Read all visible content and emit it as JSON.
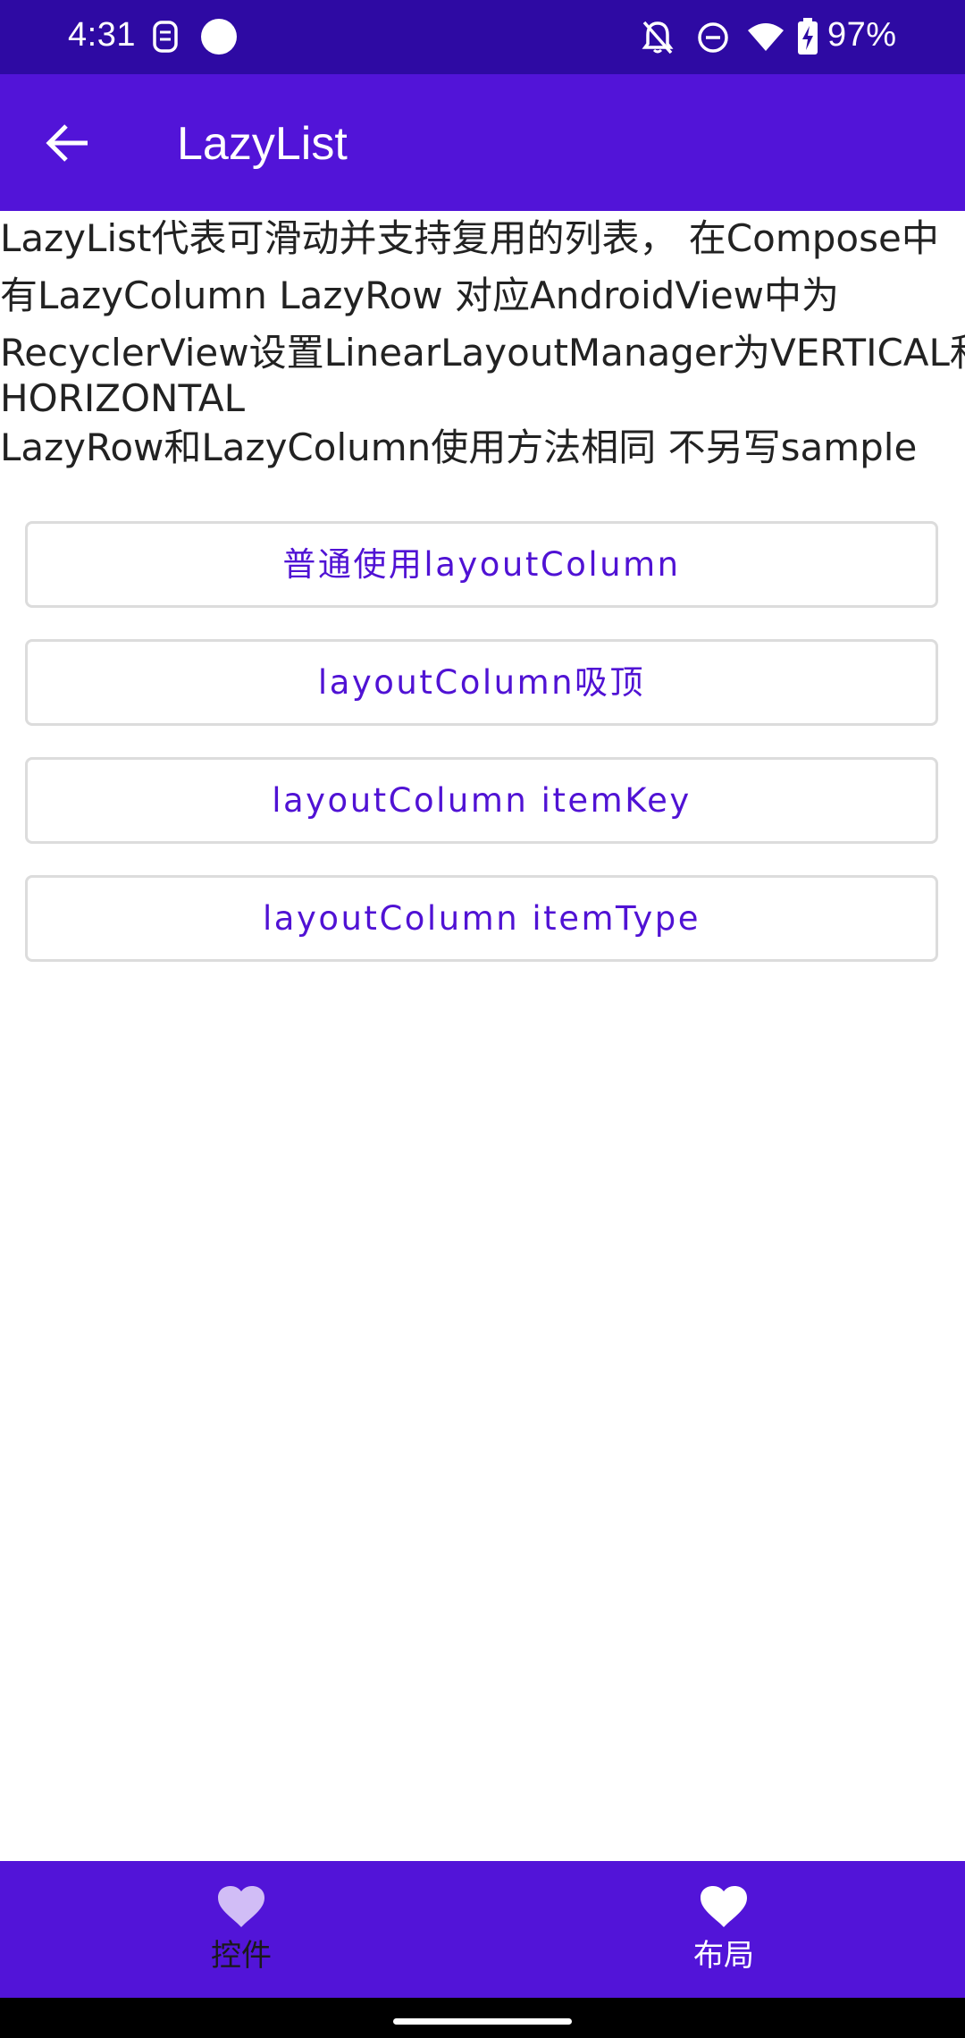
{
  "status_bar": {
    "time": "4:31",
    "battery": "97%",
    "icons": [
      "face-id-icon",
      "record-dot-icon",
      "bell-off-icon",
      "do-not-disturb-icon",
      "wifi-icon",
      "battery-charging-icon"
    ]
  },
  "app_bar": {
    "title": "LazyList",
    "back_icon": "arrow-back-icon",
    "color": "#5214d8"
  },
  "description": {
    "lines": [
      "LazyList代表可滑动并支持复用的列表， 在Compose中",
      "有LazyColumn LazyRow 对应AndroidView中为",
      "RecyclerView设置LinearLayoutManager为VERTICAL和",
      "HORIZONTAL",
      "LazyRow和LazyColumn使用方法相同 不另写sample"
    ]
  },
  "buttons": [
    {
      "label": "普通使用layoutColumn"
    },
    {
      "label": "layoutColumn吸顶"
    },
    {
      "label": "layoutColumn itemKey"
    },
    {
      "label": "layoutColumn itemType"
    }
  ],
  "bottom_nav": {
    "items": [
      {
        "label": "控件",
        "icon": "heart-icon",
        "selected": false
      },
      {
        "label": "布局",
        "icon": "heart-icon",
        "selected": true
      }
    ],
    "color": "#5214d8"
  },
  "colors": {
    "status_bar": "#2e0aa3",
    "accent": "#5214d8",
    "button_text": "#5012d4"
  }
}
